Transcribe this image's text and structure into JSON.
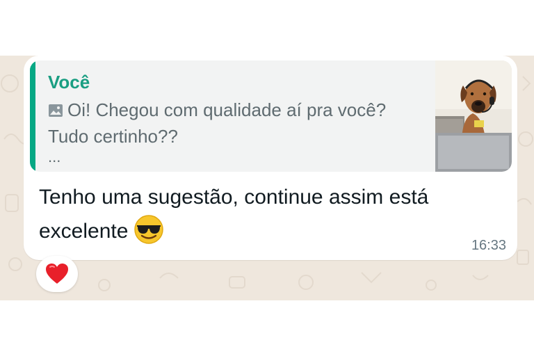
{
  "message": {
    "quoted": {
      "author": "Você",
      "media_icon": "photo-icon",
      "line1": "Oi! Chegou com qualidade aí pra você?",
      "line2": "Tudo certinho??",
      "more": "..."
    },
    "text": "Tenho uma sugestão, continue assim está excelente",
    "emoji": "smiling-face-with-sunglasses",
    "time": "16:33",
    "reaction": "red-heart"
  },
  "colors": {
    "accent": "#06a884",
    "author": "#1a9e82",
    "chat_background": "#efe7dd",
    "bubble": "#ffffff",
    "quote_background": "#f2f3f3",
    "reaction_heart": "#e8202a"
  }
}
